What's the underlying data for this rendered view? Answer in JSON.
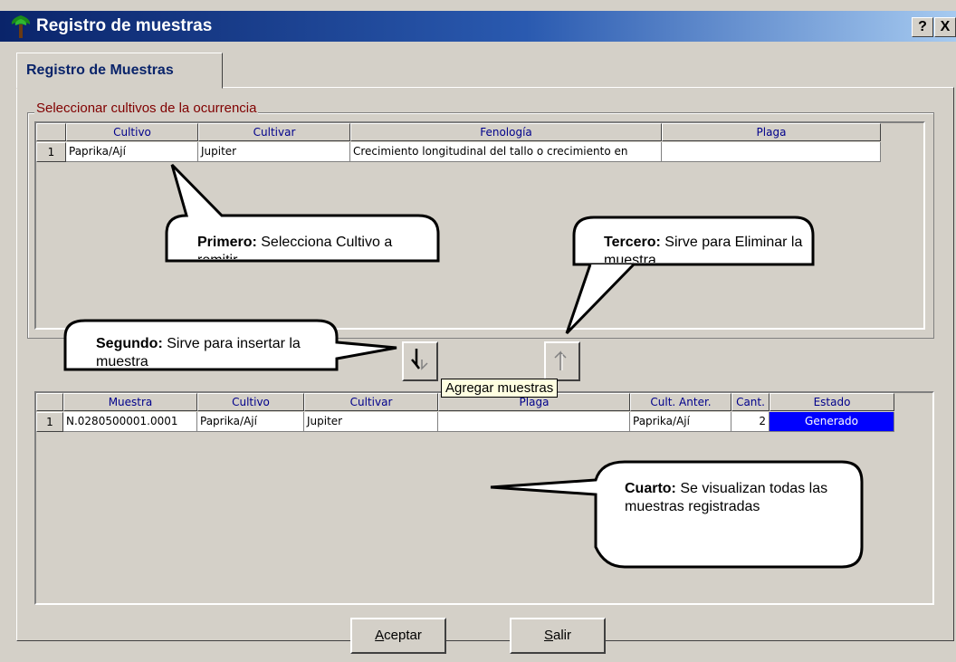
{
  "window": {
    "title": "Registro de muestras",
    "help_button": "?",
    "close_button": "X"
  },
  "tab": {
    "label": "Registro de Muestras"
  },
  "group": {
    "label": "Seleccionar cultivos de la ocurrencia"
  },
  "upper_grid": {
    "headers": [
      "",
      "Cultivo",
      "Cultivar",
      "Fenología",
      "Plaga"
    ],
    "rows": [
      {
        "num": "1",
        "cultivo": "Paprika/Ají",
        "cultivar": "Jupiter",
        "fenologia": "Crecimiento longitudinal del tallo o crecimiento en",
        "plaga": ""
      }
    ]
  },
  "lower_grid": {
    "headers": [
      "",
      "Muestra",
      "Cultivo",
      "Cultivar",
      "Plaga",
      "Cult. Anter.",
      "Cant.",
      "Estado"
    ],
    "rows": [
      {
        "num": "1",
        "muestra": "N.0280500001.0001",
        "cultivo": "Paprika/Ají",
        "cultivar": "Jupiter",
        "plaga": "",
        "cult_anter": "Paprika/Ají",
        "cant": "2",
        "estado": "Generado"
      }
    ]
  },
  "tooltip": "Agregar muestras",
  "callouts": {
    "primero": {
      "bold": "Primero:",
      "text": " Selecciona Cultivo a remitir"
    },
    "segundo": {
      "bold": "Segundo:",
      "text": " Sirve para insertar la muestra"
    },
    "tercero": {
      "bold": "Tercero:",
      "text": " Sirve para Eliminar la muestra"
    },
    "cuarto": {
      "bold": "Cuarto:",
      "text": " Se visualizan todas las muestras registradas"
    }
  },
  "buttons": {
    "accept_first": "A",
    "accept_rest": "ceptar",
    "exit_first": "S",
    "exit_rest": "alir"
  },
  "colors": {
    "titlebar_start": "#0a246a",
    "titlebar_end": "#a6caf0",
    "status_generated": "#0000ff",
    "group_label": "#800000",
    "tab_label": "#0a246a"
  },
  "icons": {
    "app": "tree-icon",
    "add": "arrow-down-icon",
    "remove": "arrow-up-icon"
  }
}
